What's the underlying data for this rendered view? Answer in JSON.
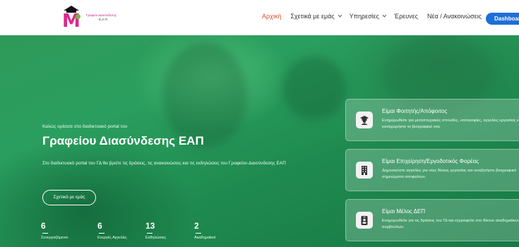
{
  "header": {
    "logo_line1": "Γραφείο Διασύνδεσης",
    "logo_line2": "Ε.Α.Π.",
    "nav": [
      {
        "label": "Αρχική",
        "active": true,
        "dropdown": false
      },
      {
        "label": "Σχετικά με εμάς",
        "active": false,
        "dropdown": true
      },
      {
        "label": "Υπηρεσίες",
        "active": false,
        "dropdown": true
      },
      {
        "label": "Έρευνες",
        "active": false,
        "dropdown": false
      },
      {
        "label": "Νέα / Ανακοινώσεις",
        "active": false,
        "dropdown": false
      }
    ],
    "dashboard_label": "Dashboard"
  },
  "hero": {
    "welcome": "Καλώς ορίσατε στο διαδικτυακό portal του",
    "title": "Γραφείου Διασύνδεσης ΕΑΠ",
    "description": "Στο διαδικτυακό portal του ΓΔ θα βρείτε τις δράσεις, τις ανακοινώσεις και τις εκδηλώσεις του Γραφείου Διασύνδεσης ΕΑΠ",
    "about_button": "Σχετικά με εμάς",
    "stats": [
      {
        "value": "6",
        "label": "Συνεργαζόμενοι"
      },
      {
        "value": "6",
        "label": "Ενεργές Αγγελίες"
      },
      {
        "value": "13",
        "label": "Εκδηλώσεις"
      },
      {
        "value": "2",
        "label": "Ακαδημαϊκοί"
      }
    ]
  },
  "cards": [
    {
      "icon": "graduate-icon",
      "title": "Είμαι Φοιτητής/Απόφοιτος",
      "text": "Ενημερωθείτε για μεταπτυχιακές σπουδές, υποτροφίες, αγγελίες εργασίας και καταχωρήστε το βιογραφικό σας"
    },
    {
      "icon": "building-icon",
      "title": "Είμαι Επιχείρηση/Εργοδοτικός Φορέας",
      "text": "Δημοσιεύστε αγγελίες για νέες θέσεις εργασίας και αναζητήστε βιογραφικά σημειώματα αποφοίτων."
    },
    {
      "icon": "id-badge-icon",
      "title": "Είμαι Μέλος ΔΕΠ",
      "text": "Ενημερωθείτε για τις δράσεις του ΓΔ και εγγραφείτε στο δίκτυο ακαδημαϊκών συμβούλων."
    }
  ],
  "colors": {
    "accent_nav": "#e0502a",
    "dashboard_button": "#1f6fd8",
    "logo_pink": "#d82a8c",
    "hero_green": "#2a9e5e"
  }
}
